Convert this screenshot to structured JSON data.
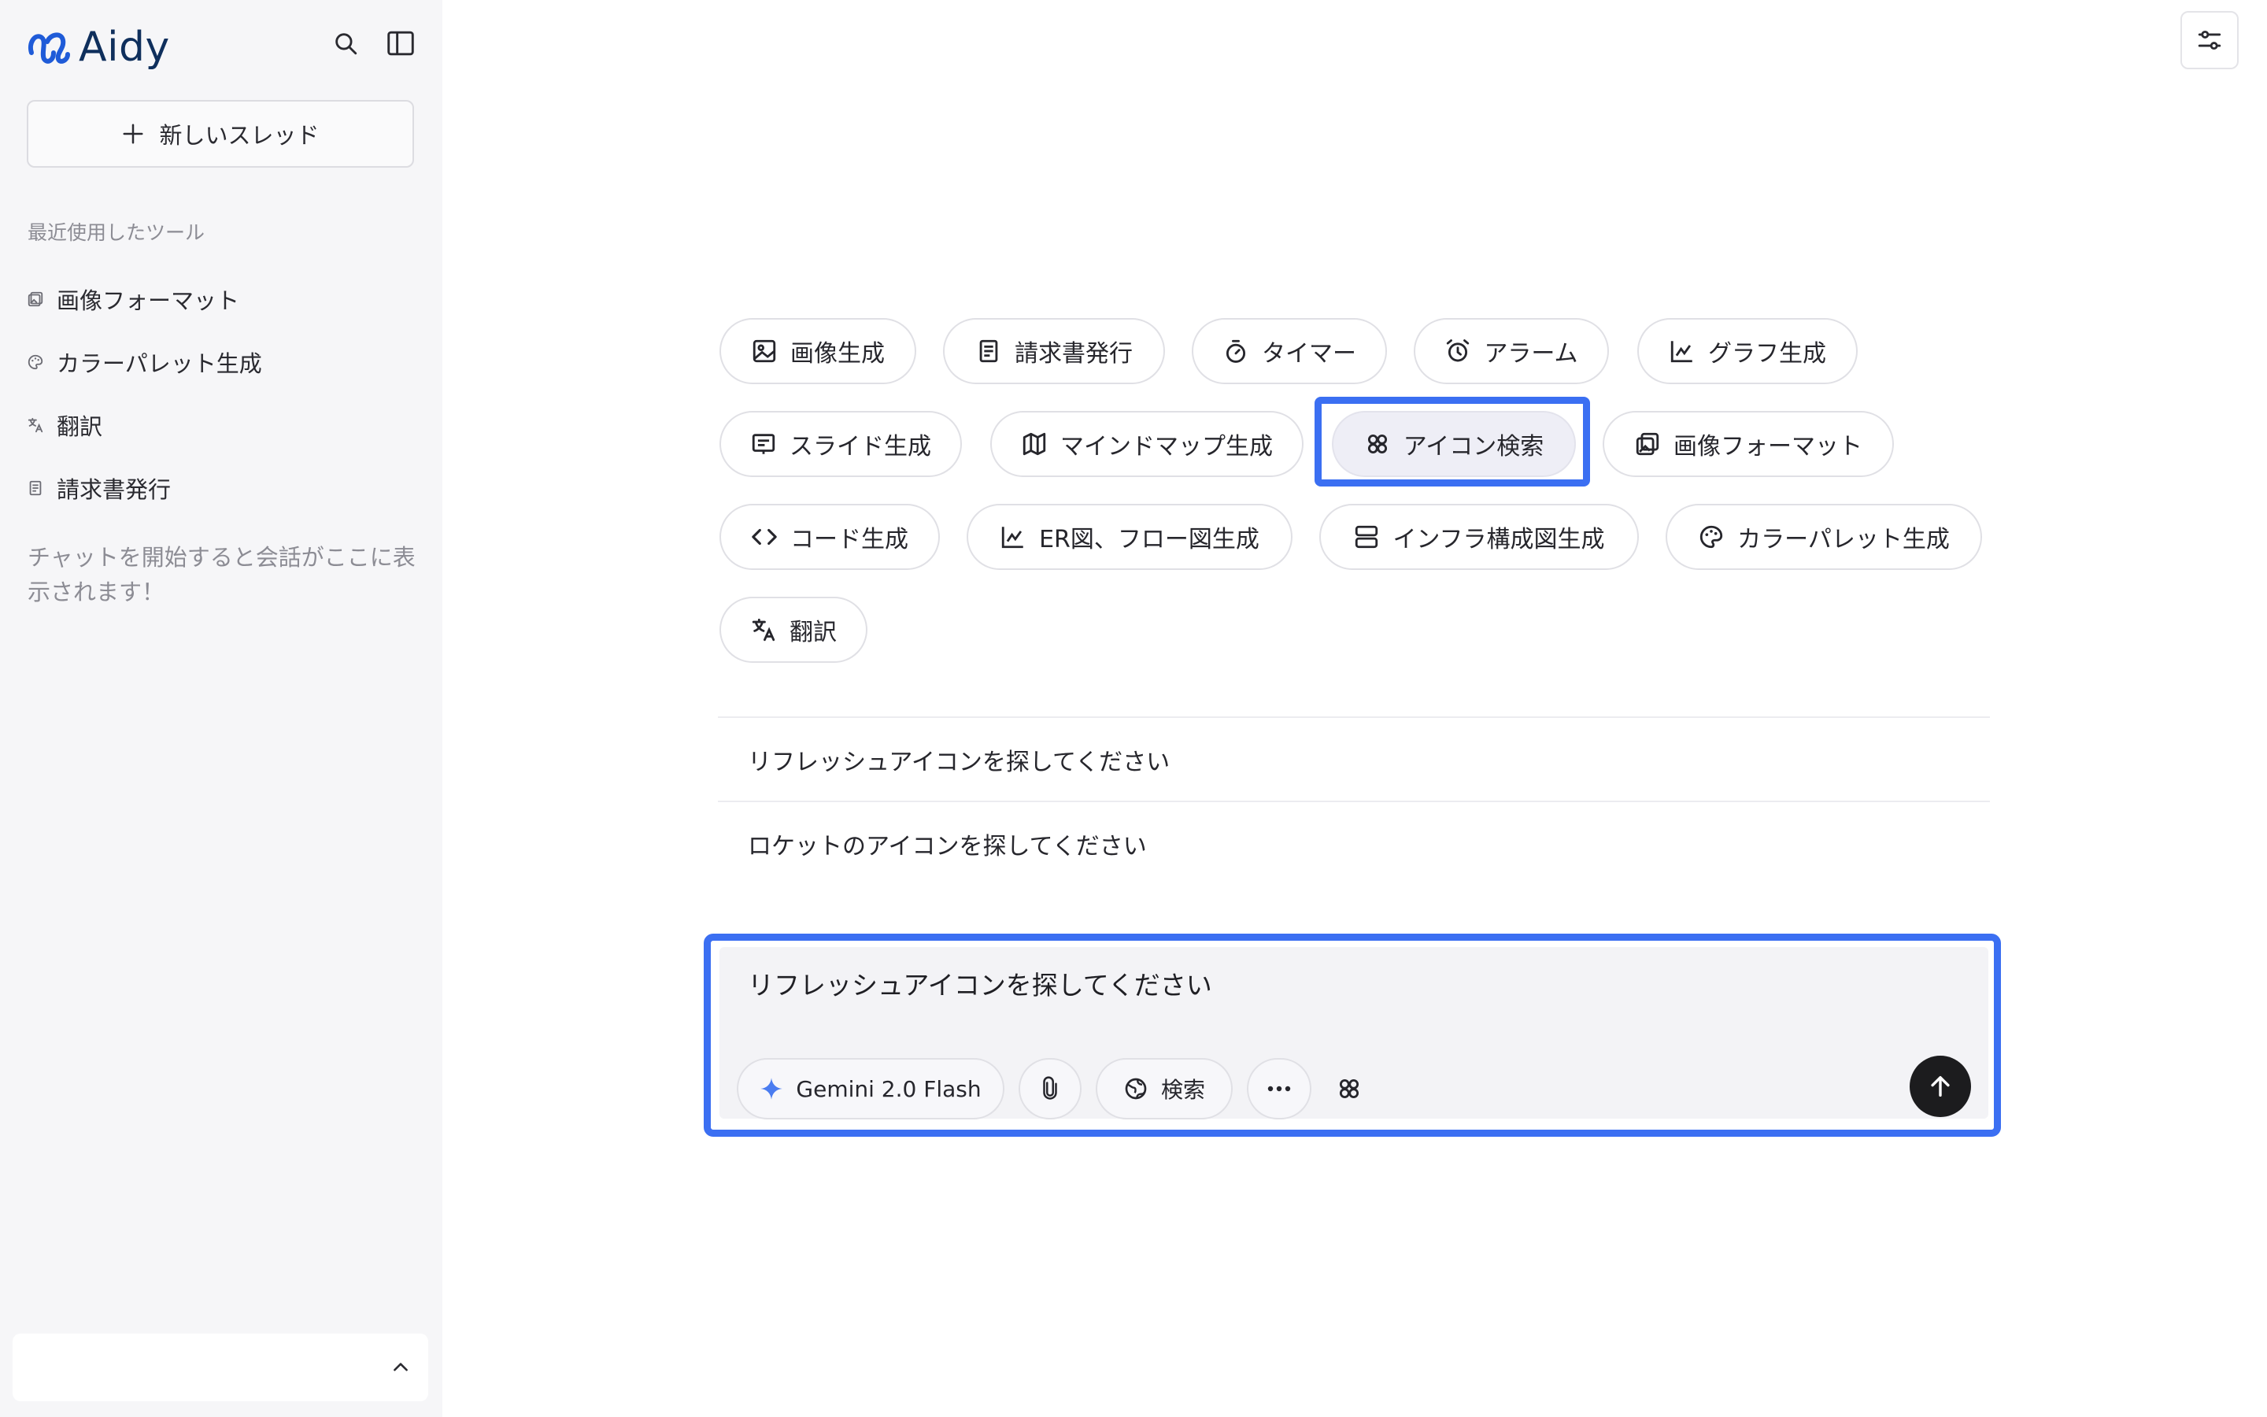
{
  "sidebar": {
    "brand": "Aidy",
    "new_thread_label": "新しいスレッド",
    "section_title": "最近使用したツール",
    "recent_items": [
      {
        "label": "画像フォーマット",
        "icon": "image-format-icon"
      },
      {
        "label": "カラーパレット生成",
        "icon": "palette-icon"
      },
      {
        "label": "翻訳",
        "icon": "translate-icon"
      },
      {
        "label": "請求書発行",
        "icon": "invoice-icon"
      }
    ],
    "empty_message": "チャットを開始すると会話がここに表示されます！"
  },
  "tools": [
    {
      "label": "画像生成",
      "icon": "image-icon"
    },
    {
      "label": "請求書発行",
      "icon": "invoice-icon"
    },
    {
      "label": "タイマー",
      "icon": "timer-icon"
    },
    {
      "label": "アラーム",
      "icon": "alarm-icon"
    },
    {
      "label": "グラフ生成",
      "icon": "chart-icon"
    },
    {
      "label": "スライド生成",
      "icon": "slides-icon"
    },
    {
      "label": "マインドマップ生成",
      "icon": "map-icon"
    },
    {
      "label": "アイコン検索",
      "icon": "icon-search-icon",
      "selected": true
    },
    {
      "label": "画像フォーマット",
      "icon": "image-format-icon"
    },
    {
      "label": "コード生成",
      "icon": "code-icon"
    },
    {
      "label": "ER図、フロー図生成",
      "icon": "chart-icon"
    },
    {
      "label": "インフラ構成図生成",
      "icon": "server-icon"
    },
    {
      "label": "カラーパレット生成",
      "icon": "palette-icon"
    },
    {
      "label": "翻訳",
      "icon": "translate-icon"
    }
  ],
  "suggestions": [
    "リフレッシュアイコンを探してください",
    "ロケットのアイコンを探してください"
  ],
  "composer": {
    "value": "リフレッシュアイコンを探してください",
    "model_label": "Gemini 2.0 Flash",
    "search_label": "検索"
  },
  "colors": {
    "accent": "#3b6ff2",
    "sidebar_bg": "#f6f6f8",
    "brand": "#0f2f5c",
    "send": "#1c1c1e"
  }
}
